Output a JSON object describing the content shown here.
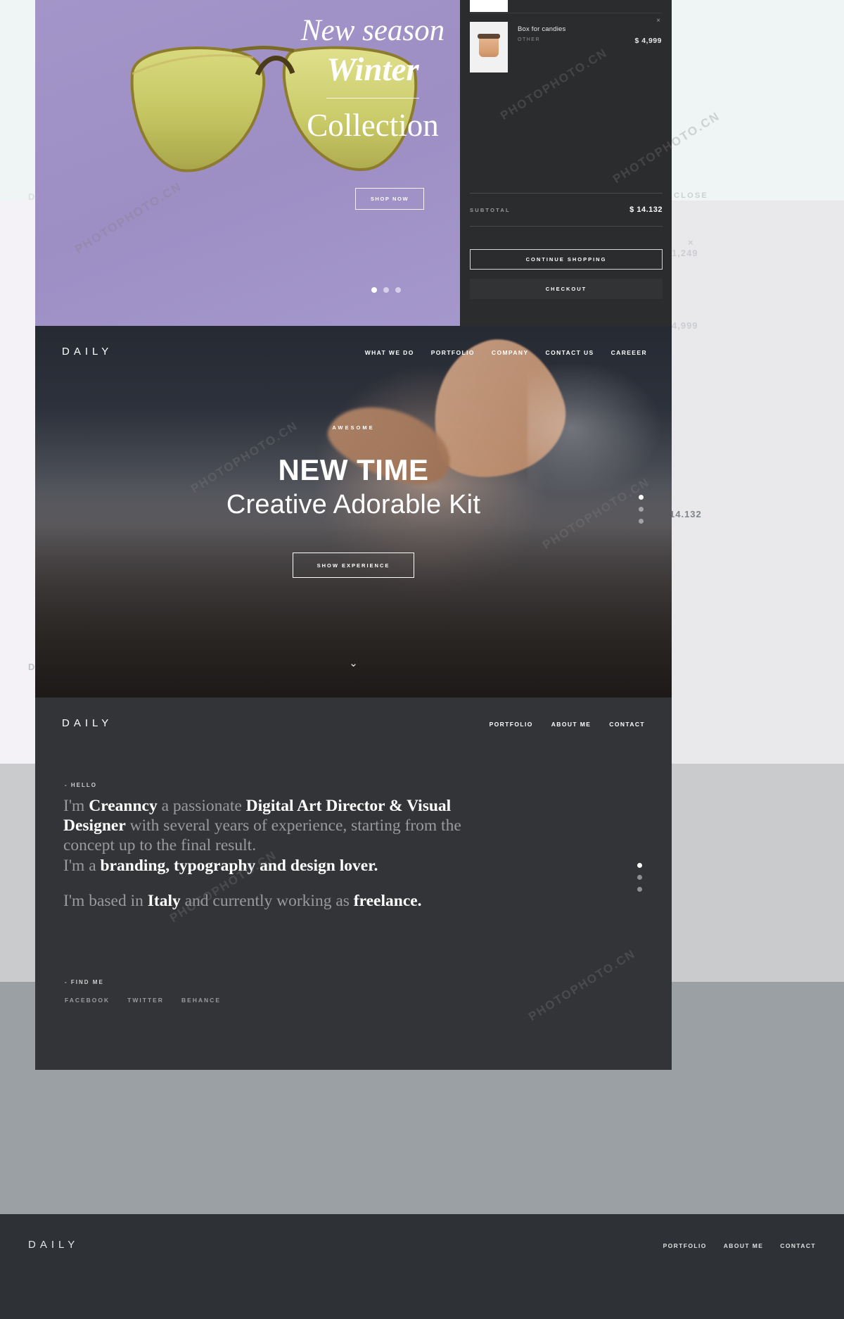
{
  "slider": {
    "line1": "New season",
    "line2": "Winter",
    "line3": "Collection",
    "cta": "SHOP NOW",
    "dots": 3,
    "active_dot": 0
  },
  "cart": {
    "items": [
      {
        "name": "Box for candies",
        "category": "OTHER",
        "price": "$ 4,999",
        "remove": "×"
      }
    ],
    "subtotal_label": "SUBTOTAL",
    "subtotal_value": "$ 14.132",
    "continue_label": "CONTINUE SHOPPING",
    "checkout_label": "CHECKOUT"
  },
  "hero": {
    "brand": "DAILY",
    "nav": [
      "WHAT WE DO",
      "PORTFOLIO",
      "COMPANY",
      "CONTACT US",
      "CAREEER"
    ],
    "eyebrow": "AWESOME",
    "title": "NEW TIME",
    "subtitle": "Creative Adorable Kit",
    "cta": "SHOW EXPERIENCE",
    "scroll_icon": "⌄",
    "dots": 3,
    "active_dot": 0
  },
  "about": {
    "brand": "DAILY",
    "nav": [
      "PORTFOLIO",
      "ABOUT ME",
      "CONTACT"
    ],
    "hello": "- HELLO",
    "bio_p1_pre": "I'm ",
    "bio_p1_name": "Creanncy",
    "bio_p1_mid": " a passionate ",
    "bio_p1_role": "Digital Art Director & Visual Designer",
    "bio_p1_tail": " with several years of experience, starting from the concept up to the final result.",
    "bio_p1_pre2": "I'm a ",
    "bio_p1_strong2": "branding, typography and design lover.",
    "bio_p2_pre": "I'm based in ",
    "bio_p2_strong": "Italy",
    "bio_p2_mid": " and currently working as ",
    "bio_p2_strong2": "freelance.",
    "findme": "- FIND ME",
    "socials": [
      "FACEBOOK",
      "TWITTER",
      "BEHANCE"
    ],
    "dots": 3,
    "active_dot": 0
  },
  "background": {
    "close_label": "CLOSE",
    "ghost_price_1": "1,249",
    "ghost_price_2": "4,999",
    "ghost_price_3": "14.132",
    "ghost_x": "×",
    "footer_brand": "DAILY",
    "footer_nav": [
      "PORTFOLIO",
      "ABOUT ME",
      "CONTACT"
    ]
  },
  "watermarks": {
    "text_a": "PHOTOPHOTO.CN",
    "text_b": "PHOTOPHOTO.CN",
    "text_c": "PHOTOPHOTO.CN"
  },
  "colors": {
    "slider_bg": "#a395c8",
    "cart_bg": "#2b2c2e",
    "about_bg": "#333437",
    "hero_dark": "#262a33",
    "accent_white": "#ffffff"
  }
}
